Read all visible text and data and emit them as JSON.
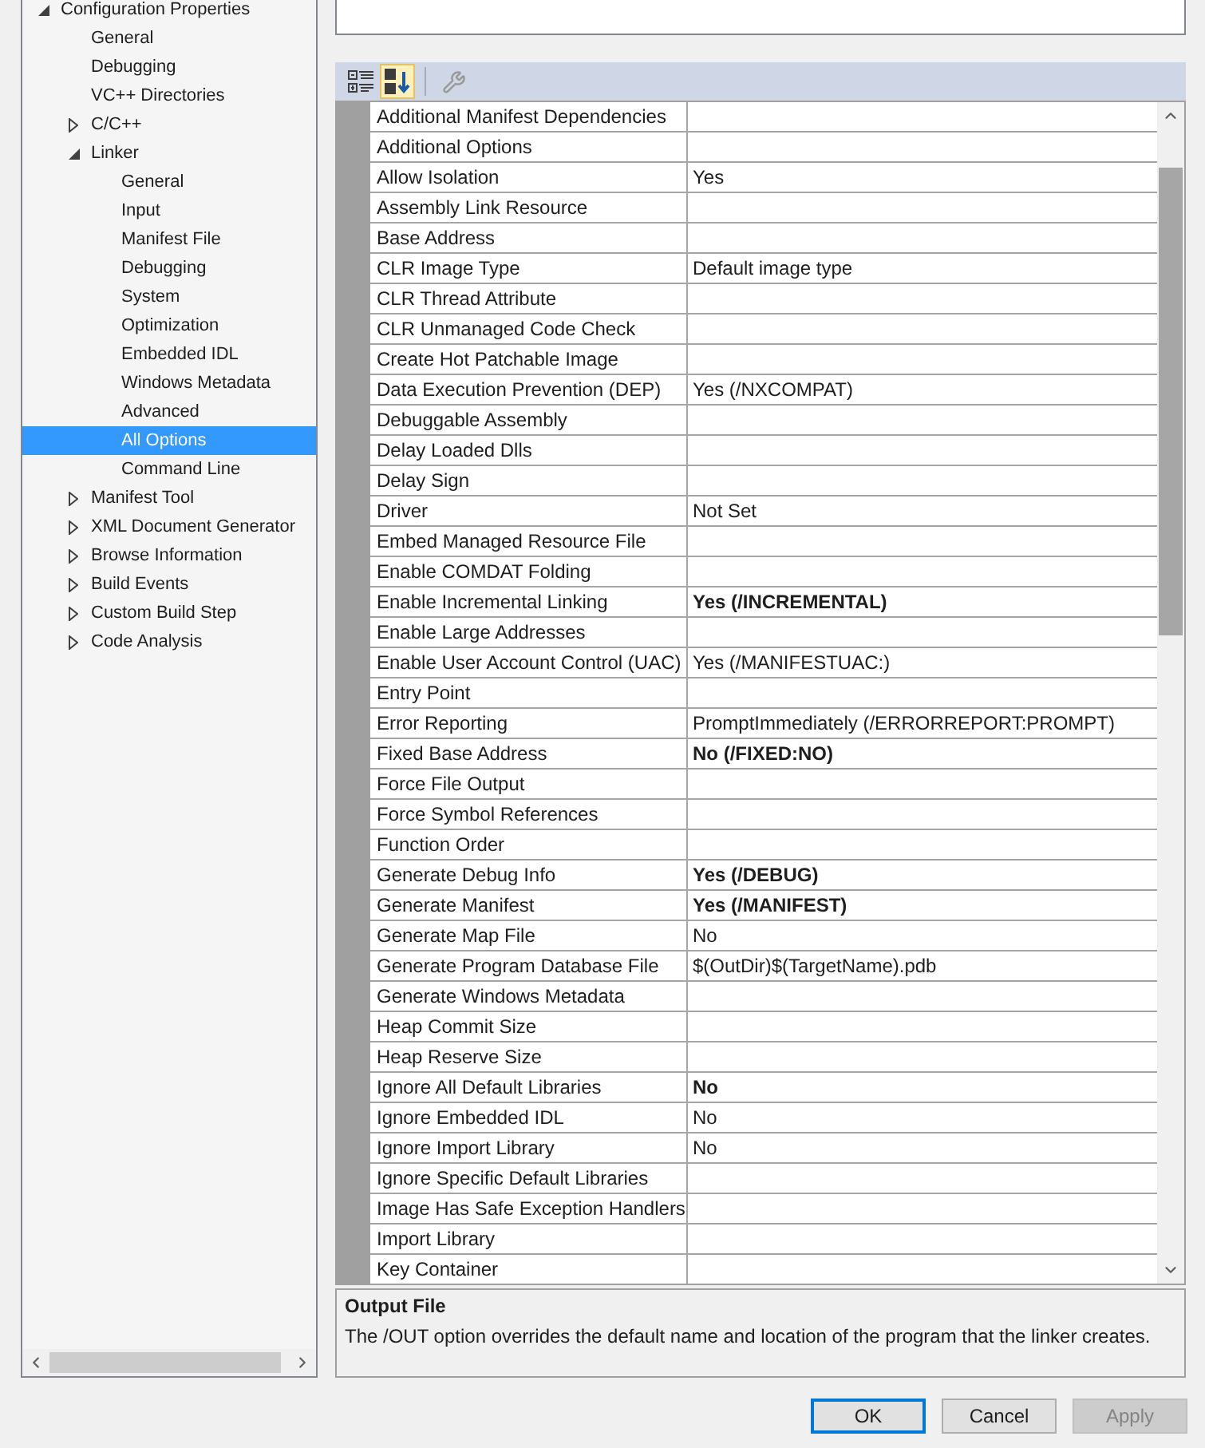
{
  "tree": {
    "items": [
      {
        "label": "Configuration Properties",
        "expanded": true,
        "selected": false,
        "children": [
          {
            "label": "General",
            "selected": false
          },
          {
            "label": "Debugging",
            "selected": false
          },
          {
            "label": "VC++ Directories",
            "selected": false
          },
          {
            "label": "C/C++",
            "expanded": false,
            "selected": false
          },
          {
            "label": "Linker",
            "expanded": true,
            "selected": false,
            "children": [
              {
                "label": "General",
                "selected": false
              },
              {
                "label": "Input",
                "selected": false
              },
              {
                "label": "Manifest File",
                "selected": false
              },
              {
                "label": "Debugging",
                "selected": false
              },
              {
                "label": "System",
                "selected": false
              },
              {
                "label": "Optimization",
                "selected": false
              },
              {
                "label": "Embedded IDL",
                "selected": false
              },
              {
                "label": "Windows Metadata",
                "selected": false
              },
              {
                "label": "Advanced",
                "selected": false
              },
              {
                "label": "All Options",
                "selected": true
              },
              {
                "label": "Command Line",
                "selected": false
              }
            ]
          },
          {
            "label": "Manifest Tool",
            "expanded": false,
            "selected": false
          },
          {
            "label": "XML Document Generator",
            "expanded": false,
            "selected": false
          },
          {
            "label": "Browse Information",
            "expanded": false,
            "selected": false
          },
          {
            "label": "Build Events",
            "expanded": false,
            "selected": false
          },
          {
            "label": "Custom Build Step",
            "expanded": false,
            "selected": false
          },
          {
            "label": "Code Analysis",
            "expanded": false,
            "selected": false
          }
        ]
      }
    ]
  },
  "toolbar": {
    "buttons": [
      {
        "kind": "categorized",
        "selected": false,
        "disabled": false
      },
      {
        "kind": "alphabetical",
        "selected": true,
        "disabled": false
      },
      {
        "kind": "separator"
      },
      {
        "kind": "property_pages",
        "selected": false,
        "disabled": true
      }
    ]
  },
  "grid": {
    "rows": [
      {
        "name": "Additional Manifest Dependencies"
      },
      {
        "name": "Additional Options"
      },
      {
        "name": "Allow Isolation",
        "value": "Yes",
        "modified": false
      },
      {
        "name": "Assembly Link Resource"
      },
      {
        "name": "Base Address"
      },
      {
        "name": "CLR Image Type",
        "value": "Default image type",
        "modified": false
      },
      {
        "name": "CLR Thread Attribute"
      },
      {
        "name": "CLR Unmanaged Code Check"
      },
      {
        "name": "Create Hot Patchable Image"
      },
      {
        "name": "Data Execution Prevention (DEP)",
        "value": "Yes (/NXCOMPAT)",
        "modified": false
      },
      {
        "name": "Debuggable Assembly"
      },
      {
        "name": "Delay Loaded Dlls"
      },
      {
        "name": "Delay Sign"
      },
      {
        "name": "Driver",
        "value": "Not Set",
        "modified": false
      },
      {
        "name": "Embed Managed Resource File"
      },
      {
        "name": "Enable COMDAT Folding"
      },
      {
        "name": "Enable Incremental Linking",
        "value": "Yes (/INCREMENTAL)",
        "modified": true
      },
      {
        "name": "Enable Large Addresses"
      },
      {
        "name": "Enable User Account Control (UAC)",
        "value": "Yes (/MANIFESTUAC:)",
        "modified": false
      },
      {
        "name": "Entry Point"
      },
      {
        "name": "Error Reporting",
        "value": "PromptImmediately (/ERRORREPORT:PROMPT)",
        "modified": false
      },
      {
        "name": "Fixed Base Address",
        "value": "No (/FIXED:NO)",
        "modified": true
      },
      {
        "name": "Force File Output"
      },
      {
        "name": "Force Symbol References"
      },
      {
        "name": "Function Order"
      },
      {
        "name": "Generate Debug Info",
        "value": "Yes (/DEBUG)",
        "modified": true
      },
      {
        "name": "Generate Manifest",
        "value": "Yes (/MANIFEST)",
        "modified": true
      },
      {
        "name": "Generate Map File",
        "value": "No",
        "modified": false
      },
      {
        "name": "Generate Program Database File",
        "value": "$(OutDir)$(TargetName).pdb",
        "modified": false
      },
      {
        "name": "Generate Windows Metadata"
      },
      {
        "name": "Heap Commit Size"
      },
      {
        "name": "Heap Reserve Size"
      },
      {
        "name": "Ignore All Default Libraries",
        "value": "No",
        "modified": true
      },
      {
        "name": "Ignore Embedded IDL",
        "value": "No",
        "modified": false
      },
      {
        "name": "Ignore Import Library",
        "value": "No",
        "modified": false
      },
      {
        "name": "Ignore Specific Default Libraries"
      },
      {
        "name": "Image Has Safe Exception Handlers"
      },
      {
        "name": "Import Library"
      },
      {
        "name": "Key Container"
      }
    ]
  },
  "description": {
    "title": "Output File",
    "text": "The /OUT option overrides the default name and location of the program that the linker creates."
  },
  "buttons": [
    {
      "label": "OK",
      "default": true,
      "disabled": false
    },
    {
      "label": "Cancel",
      "default": false,
      "disabled": false
    },
    {
      "label": "Apply",
      "default": false,
      "disabled": true
    }
  ]
}
